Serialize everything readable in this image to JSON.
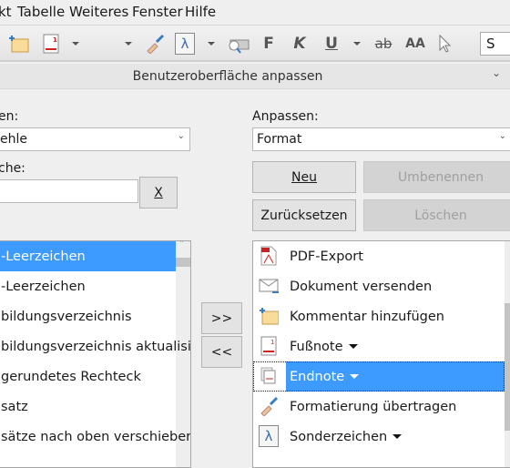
{
  "menu": {
    "items": [
      {
        "label": "kt"
      },
      {
        "label": "Tabelle",
        "u": "T"
      },
      {
        "label": "Weiteres",
        "u": "W"
      },
      {
        "label": "Fenster",
        "u": "n"
      },
      {
        "label": "Hilfe",
        "u": "H"
      }
    ]
  },
  "toolbar": {
    "bold": "F",
    "italic": "K",
    "underline": "U",
    "strike": "ab",
    "case": "AA",
    "style_box": "S"
  },
  "panel": {
    "title": "Benutzeroberfläche anpassen"
  },
  "left": {
    "category_label": "en:",
    "category_value": "ehle",
    "search_label": "che:",
    "search_value": "",
    "clear_label": "X",
    "items": [
      "-Leerzeichen",
      "-Leerzeichen",
      "bildungsverzeichnis",
      "bildungsverzeichnis aktualisi",
      "gerundetes Rechteck",
      "satz",
      "sätze nach oben verschieber"
    ]
  },
  "transfer": {
    "add": ">>",
    "remove": "<<"
  },
  "right": {
    "customize_label": "Anpassen:",
    "customize_value": "Format",
    "new": "Neu",
    "rename": "Umbenennen",
    "reset": "Zurücksetzen",
    "delete": "Löschen",
    "items": [
      {
        "label": "PDF-Export",
        "icon": "pdf-icon"
      },
      {
        "label": "Dokument versenden",
        "icon": "mail-icon"
      },
      {
        "label": "Kommentar hinzufügen",
        "icon": "comment-icon"
      },
      {
        "label": "Fußnote",
        "icon": "footnote-icon",
        "dropdown": true
      },
      {
        "label": "Endnote",
        "icon": "endnote-icon",
        "dropdown": true
      },
      {
        "label": "Formatierung übertragen",
        "icon": "clone-brush-icon"
      },
      {
        "label": "Sonderzeichen",
        "icon": "special-char-icon",
        "dropdown": true
      }
    ]
  },
  "colors": {
    "selection": "#3d9bff"
  }
}
